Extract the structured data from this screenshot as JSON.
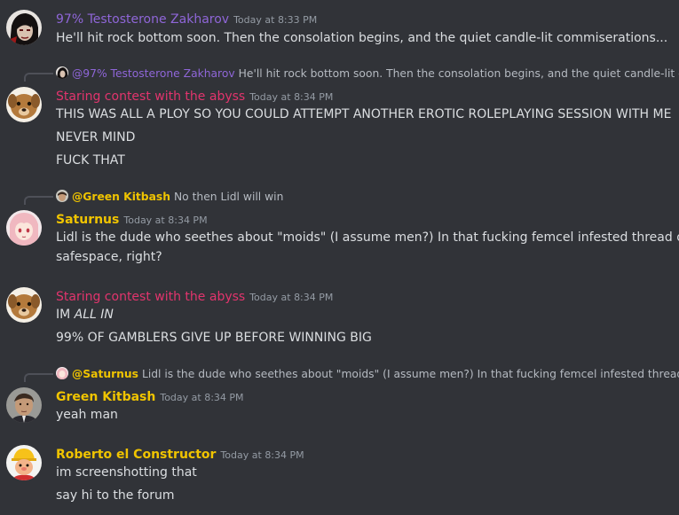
{
  "colors": {
    "background": "#313338",
    "text": "#dbdee1",
    "muted": "#949ba4",
    "purple": "#8f66d8",
    "pink": "#e2346d",
    "gold": "#f0c400"
  },
  "messages": [
    {
      "author": "97% Testosterone Zakharov",
      "timestamp": "Today at 8:33 PM",
      "avatar_icon": "dark-haired-portrait-avatar",
      "lines": [
        "He'll hit rock bottom soon. Then the consolation begins, and the quiet candle-lit commiserations..."
      ]
    },
    {
      "reply": {
        "author": "@97% Testosterone Zakharov",
        "text": "He'll hit rock bottom soon. Then the consolation begins, and the quiet candle-lit com"
      },
      "author": "Staring contest with the abyss",
      "timestamp": "Today at 8:34 PM",
      "avatar_icon": "dog-avatar",
      "lines": [
        "THIS WAS ALL A PLOY SO YOU COULD ATTEMPT ANOTHER EROTIC ROLEPLAYING SESSION WITH ME",
        "NEVER MIND",
        "FUCK THAT"
      ]
    },
    {
      "reply": {
        "author": "@Green Kitbash",
        "text": "No then Lidl will win"
      },
      "author": "Saturnus",
      "timestamp": "Today at 8:34 PM",
      "avatar_icon": "anime-girl-avatar",
      "lines": [
        "Lidl is the dude who seethes about \"moids\" (I assume men?) In that fucking femcel infested thread on the",
        "safespace, right?"
      ]
    },
    {
      "author": "Staring contest with the abyss",
      "timestamp": "Today at 8:34 PM",
      "avatar_icon": "dog-avatar",
      "lines_rich": {
        "line1_prefix": "IM ",
        "line1_em": "ALL IN",
        "line2": "99% OF GAMBLERS GIVE UP BEFORE WINNING BIG"
      }
    },
    {
      "reply": {
        "author": "@Saturnus",
        "text": "Lidl is the dude who seethes about \"moids\" (I assume men?) In that fucking femcel infested thread on th"
      },
      "author": "Green Kitbash",
      "timestamp": "Today at 8:34 PM",
      "avatar_icon": "man-portrait-avatar",
      "lines": [
        "yeah man"
      ]
    },
    {
      "author": "Roberto el Constructor",
      "timestamp": "Today at 8:34 PM",
      "avatar_icon": "builder-character-avatar",
      "lines": [
        "im screenshotting that",
        "say hi to the forum"
      ]
    }
  ]
}
